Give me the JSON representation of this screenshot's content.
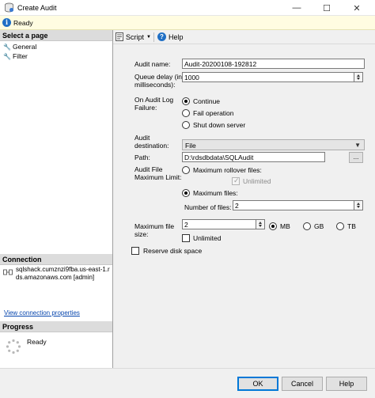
{
  "window": {
    "title": "Create Audit",
    "minimize": "—",
    "maximize": "☐",
    "close": "✕"
  },
  "status": {
    "text": "Ready"
  },
  "left": {
    "select_page_header": "Select a page",
    "pages": [
      "General",
      "Filter"
    ],
    "connection_header": "Connection",
    "connection_lines": [
      "sqlshack.cumznzi9fba.us-east-1.r",
      "ds.amazonaws.com [admin]"
    ],
    "view_connection_link": "View connection properties",
    "progress_header": "Progress",
    "progress_status": "Ready"
  },
  "toolbar": {
    "script_label": "Script",
    "help_label": "Help"
  },
  "form": {
    "audit_name_label": "Audit name:",
    "audit_name_value": "Audit-20200108-192812",
    "queue_delay_label_1": "Queue delay (in",
    "queue_delay_label_2": "milliseconds):",
    "queue_delay_value": "1000",
    "on_failure_label_1": "On Audit Log",
    "on_failure_label_2": "Failure:",
    "failure_options": [
      "Continue",
      "Fail operation",
      "Shut down server"
    ],
    "failure_selected": "Continue",
    "destination_label_1": "Audit",
    "destination_label_2": "destination:",
    "destination_value": "File",
    "path_label": "Path:",
    "path_value": "D:\\rdsdbdata\\SQLAudit",
    "browse_label": "...",
    "max_limit_label_1": "Audit File",
    "max_limit_label_2": "Maximum Limit:",
    "max_rollover_label": "Maximum rollover files:",
    "unlimited_label": "Unlimited",
    "max_files_label": "Maximum files:",
    "max_files_selected": true,
    "number_of_files_label": "Number of files:",
    "number_of_files_value": "2",
    "max_file_size_label_1": "Maximum file",
    "max_file_size_label_2": "size:",
    "max_file_size_value": "2",
    "size_units": [
      "MB",
      "GB",
      "TB"
    ],
    "size_unit_selected": "MB",
    "size_unlimited_label": "Unlimited",
    "reserve_disk_label": "Reserve disk space"
  },
  "buttons": {
    "ok": "OK",
    "cancel": "Cancel",
    "help": "Help"
  },
  "colors": {
    "status_bg": "#fffce1",
    "info_icon": "#1f6fc5",
    "link": "#0645ad",
    "primary_border": "#0078d7"
  }
}
